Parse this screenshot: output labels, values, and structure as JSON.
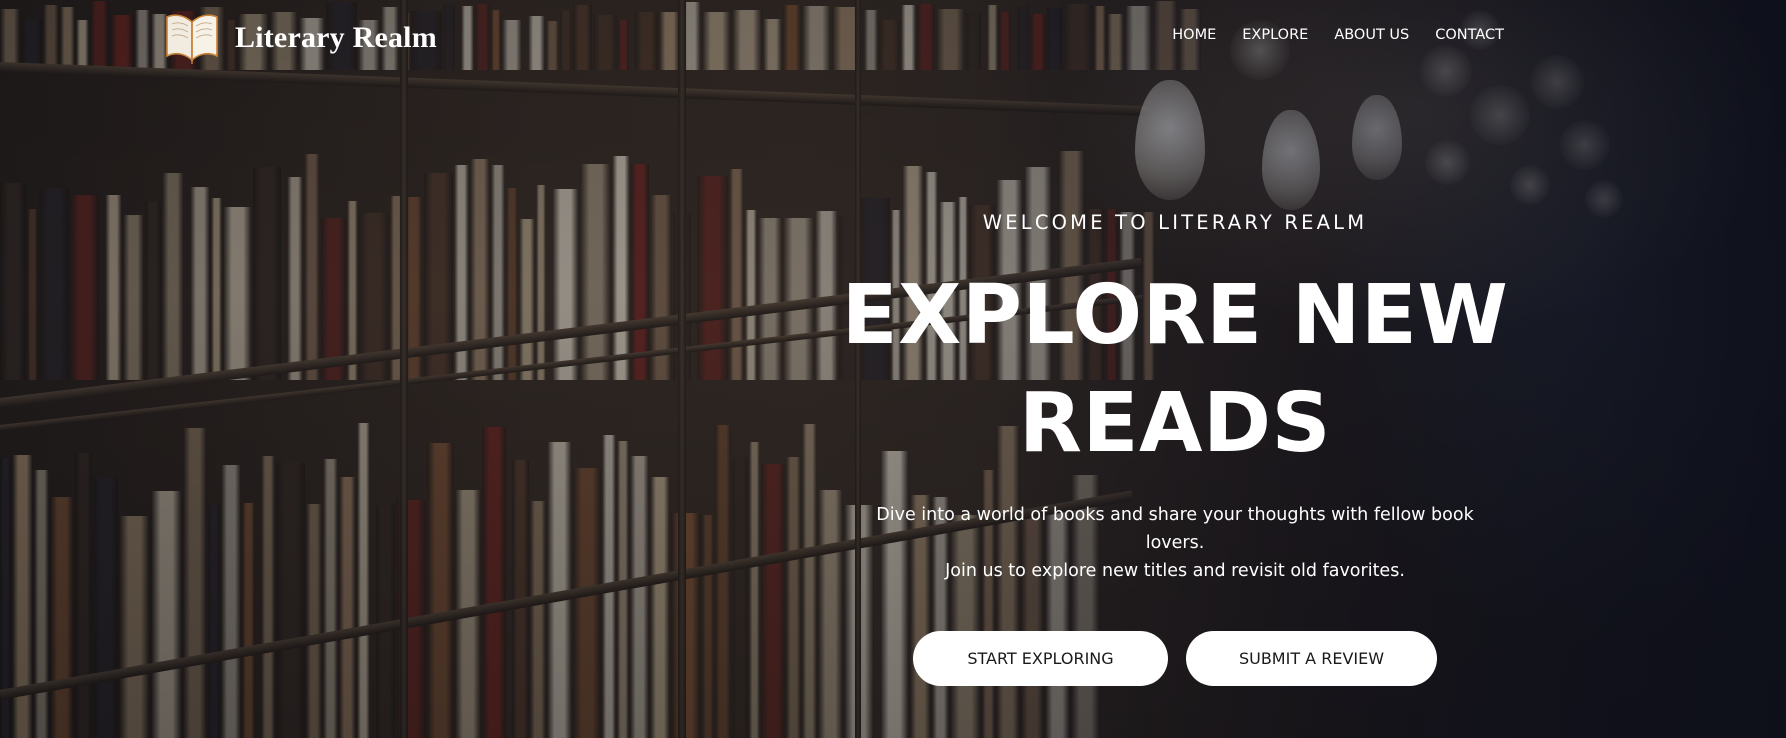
{
  "brand": {
    "name": "Literary Realm",
    "logo_icon": "open-book-icon"
  },
  "nav": {
    "links": [
      "HOME",
      "EXPLORE",
      "ABOUT US",
      "CONTACT"
    ]
  },
  "hero": {
    "eyebrow": "WELCOME TO LITERARY REALM",
    "headline_line1": "EXPLORE NEW",
    "headline_line2": "READS",
    "subtext_line1": "Dive into a world of books and share your thoughts with fellow book lovers.",
    "subtext_line2": "Join us to explore new titles and revisit old favorites.",
    "primary_cta": "START EXPLORING",
    "secondary_cta": "SUBMIT A REVIEW"
  },
  "colors": {
    "text": "#ffffff",
    "button_bg": "#ffffff",
    "button_text": "#1a1a1a",
    "logo_accent": "#c9823a"
  }
}
